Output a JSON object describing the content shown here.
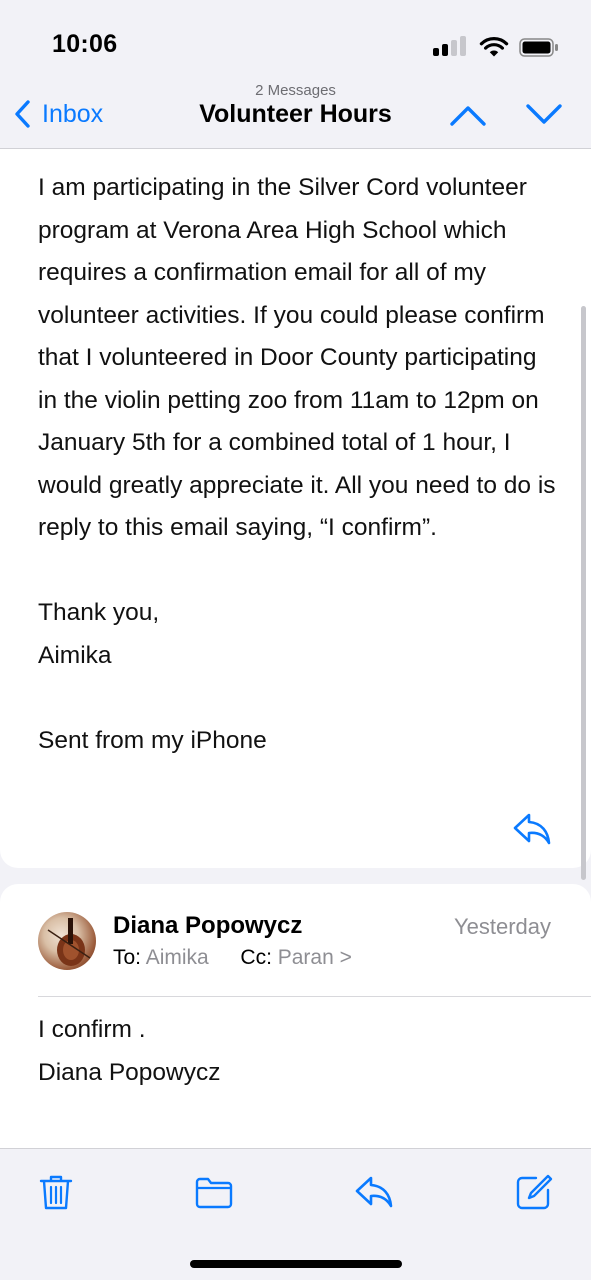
{
  "status_bar": {
    "time": "10:06",
    "icons": [
      "cellular-signal-icon",
      "wifi-icon",
      "battery-icon"
    ]
  },
  "nav": {
    "back_label": "Inbox",
    "subtitle": "2 Messages",
    "title": "Volunteer Hours",
    "icons": [
      "chevron-left-icon",
      "chevron-up-icon",
      "chevron-down-icon"
    ]
  },
  "message1": {
    "paragraphs": [
      "I am participating in the Silver Cord volunteer program at Verona Area High School which requires a confirmation email for all of my volunteer activities. If you could please confirm that I volunteered in Door County participating in the violin petting zoo from 11am to 12pm on January 5th for a combined total of 1 hour, I would greatly appreciate it. All you need to do is reply to this email saying, “I confirm”."
    ],
    "sign_off": "Thank you,",
    "signature": "Aimika",
    "footer": "Sent from my iPhone"
  },
  "message2": {
    "sender": "Diana Popowycz",
    "date": "Yesterday",
    "to_label": "To:",
    "to_value": "Aimika",
    "cc_label": "Cc:",
    "cc_value": "Paran",
    "cc_chevron": ">",
    "body_line1": "I confirm .",
    "body_line2": "Diana Popowycz"
  },
  "toolbar": {
    "items": [
      "trash-icon",
      "folder-icon",
      "reply-icon",
      "compose-icon"
    ]
  },
  "colors": {
    "accent": "#0a7aff",
    "background": "#f2f2f7",
    "secondary_text": "#8e8e93"
  }
}
